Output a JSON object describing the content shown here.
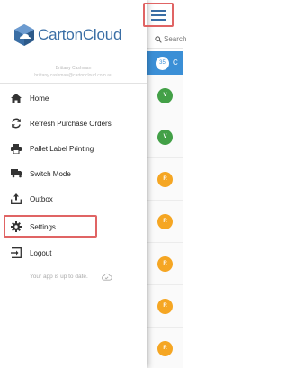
{
  "drawer": {
    "logo_text": "CartonCloud",
    "user_name": "Brittany Cashman",
    "user_email": "brittany.cashman@cartoncloud.com.au",
    "menu": [
      {
        "label": "Home",
        "icon": "home-icon"
      },
      {
        "label": "Refresh Purchase Orders",
        "icon": "refresh-icon"
      },
      {
        "label": "Pallet Label Printing",
        "icon": "print-icon"
      },
      {
        "label": "Switch Mode",
        "icon": "truck-icon"
      },
      {
        "label": "Outbox",
        "icon": "outbox-icon"
      },
      {
        "label": "Settings",
        "icon": "gear-icon"
      },
      {
        "label": "Logout",
        "icon": "logout-icon"
      }
    ],
    "status_text": "Your app is up to date.",
    "status_icon": "cloud-check-icon"
  },
  "list": {
    "search_placeholder": "Search",
    "count": "35",
    "count_label": "C",
    "rows": [
      {
        "avatar": "V",
        "color": "#43a047"
      },
      {
        "avatar": "V",
        "color": "#43a047"
      },
      {
        "avatar": "R",
        "color": "#f5a623"
      },
      {
        "avatar": "R",
        "color": "#f5a623"
      },
      {
        "avatar": "R",
        "color": "#f5a623"
      },
      {
        "avatar": "R",
        "color": "#f5a623"
      },
      {
        "avatar": "R",
        "color": "#f5a623"
      }
    ]
  },
  "colors": {
    "brand": "#3a6ea5",
    "header_blue": "#3b8fd6",
    "highlight": "#e06464"
  }
}
